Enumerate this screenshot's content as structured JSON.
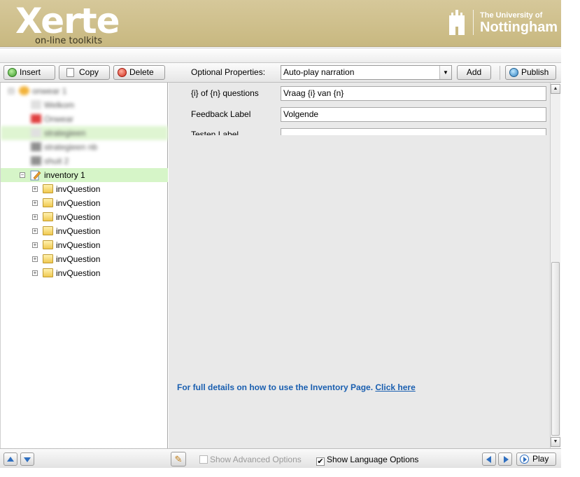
{
  "header": {
    "logo_main": "Xerte",
    "logo_sub": "on-line toolkits",
    "university_line1": "The University of",
    "university_line2": "Nottingham"
  },
  "toolbar": {
    "insert_label": "Insert",
    "copy_label": "Copy",
    "delete_label": "Delete",
    "optional_properties_label": "Optional Properties:",
    "optional_properties_value": "Auto-play narration",
    "add_label": "Add",
    "publish_label": "Publish"
  },
  "tree": {
    "blurred_items": [
      "onwear 1",
      "Welkom",
      "Onwear",
      "strategieen",
      "strategieen nb",
      "shuit 2"
    ],
    "selected_item": "inventory 1",
    "children": [
      "invQuestion",
      "invQuestion",
      "invQuestion",
      "invQuestion",
      "invQuestion",
      "invQuestion",
      "invQuestion"
    ]
  },
  "properties": {
    "questions_label": "{i} of {n} questions",
    "questions_value": "Vraag {i} van {n}",
    "feedback_label": "Feedback Label",
    "feedback_value": "Volgende",
    "next_label": "Testen Label"
  },
  "help": {
    "text": "For full details on how to use the Inventory Page.",
    "link": "Click here"
  },
  "footer": {
    "show_advanced_label": "Show Advanced Options",
    "show_language_label": "Show Language Options",
    "play_label": "Play",
    "show_advanced_checked": false,
    "show_language_checked": true
  }
}
